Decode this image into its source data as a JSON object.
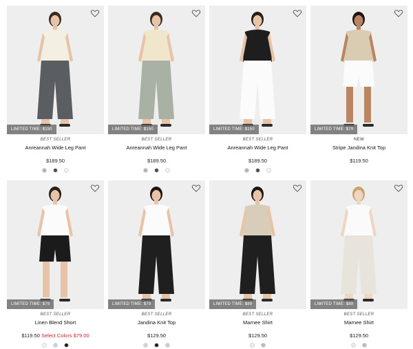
{
  "products": [
    {
      "badge": "LIMITED TIME: $150",
      "tag": "BEST SELLER",
      "name": "Anreannah Wide Leg Pant",
      "price": "$189.50",
      "sale_price": "",
      "sale_label": "",
      "swatches": [
        "#b3b3b3",
        "#4a4a4a",
        "#f4f4f2"
      ],
      "outfit": {
        "top": "#f3efe3",
        "bottom": "#5a5d62",
        "skin": "#e7c4a8",
        "hair": "#3a2a22"
      },
      "bg": "#eeeeee"
    },
    {
      "badge": "LIMITED TIME: $150",
      "tag": "BEST SELLER",
      "name": "Anreannah Wide Leg Pant",
      "price": "$189.50",
      "sale_price": "",
      "sale_label": "",
      "swatches": [
        "#b3b3b3",
        "#4a4a4a",
        "#f4f4f2"
      ],
      "outfit": {
        "top": "#efe6cc",
        "bottom": "#a8b1a3",
        "skin": "#e7c4a8",
        "hair": "#3a2a22"
      },
      "bg": "#eeeeee"
    },
    {
      "badge": "LIMITED TIME: $150",
      "tag": "BEST SELLER",
      "name": "Anreannah Wide Leg Pant",
      "price": "$189.50",
      "sale_price": "",
      "sale_label": "",
      "swatches": [
        "#b3b3b3",
        "#4a4a4a",
        "#f4f4f2"
      ],
      "outfit": {
        "top": "#1e1e1e",
        "bottom": "#fbfbfb",
        "skin": "#e7c4a8",
        "hair": "#2a1e18"
      },
      "bg": "#eeeeee"
    },
    {
      "badge": "LIMITED TIME: $79",
      "tag": "NEW",
      "name": "Stripe Jandina Knit Top",
      "price": "$119.50",
      "sale_price": "",
      "sale_label": "",
      "swatches": [],
      "outfit": {
        "top": "#d9ccb3",
        "bottom": "#fbfbfb",
        "skin": "#b98563",
        "hair": "#1e1410"
      },
      "bg": "#eeeeee"
    },
    {
      "badge": "LIMITED TIME: $79",
      "tag": "BEST SELLER",
      "name": "Linen Blend Short",
      "price": "$119.50",
      "sale_price": "$79.00",
      "sale_label": "Select Colors",
      "swatches": [
        "#f4f4f2",
        "#c5d3df",
        "#1a1a1a"
      ],
      "outfit": {
        "top": "#fbfbfb",
        "bottom": "#1b1b1b",
        "skin": "#e7c4a8",
        "hair": "#2a1e18"
      },
      "bg": "#eeeeee"
    },
    {
      "badge": "LIMITED TIME: $79",
      "tag": "BEST SELLER",
      "name": "Jandina Knit Top",
      "price": "$129.50",
      "sale_price": "",
      "sale_label": "",
      "swatches": [
        "#d2d2d2",
        "#1a1a1a",
        "#c5cddb"
      ],
      "outfit": {
        "top": "#fbfbfb",
        "bottom": "#1f1f1f",
        "skin": "#e7c4a8",
        "hair": "#1e1410"
      },
      "bg": "#eeeeee"
    },
    {
      "badge": "LIMITED TIME: $89",
      "tag": "BEST SELLER",
      "name": "Marnee Shirt",
      "price": "$129.50",
      "sale_price": "",
      "sale_label": "",
      "swatches": [
        "#ebebeb",
        "#c9b8a3"
      ],
      "outfit": {
        "top": "#d7cdb8",
        "bottom": "#1f1f1f",
        "skin": "#e7c4a8",
        "hair": "#1e1410"
      },
      "bg": "#eeeeee"
    },
    {
      "badge": "LIMITED TIME: $89",
      "tag": "BEST SELLER",
      "name": "Marnee Shirt",
      "price": "$129.50",
      "sale_price": "",
      "sale_label": "",
      "swatches": [
        "#ebebeb",
        "#c9b8a3"
      ],
      "outfit": {
        "top": "#fafafa",
        "bottom": "#e8e4dc",
        "skin": "#f0d6c2",
        "hair": "#c8a46e"
      },
      "bg": "#eeeeee"
    }
  ]
}
